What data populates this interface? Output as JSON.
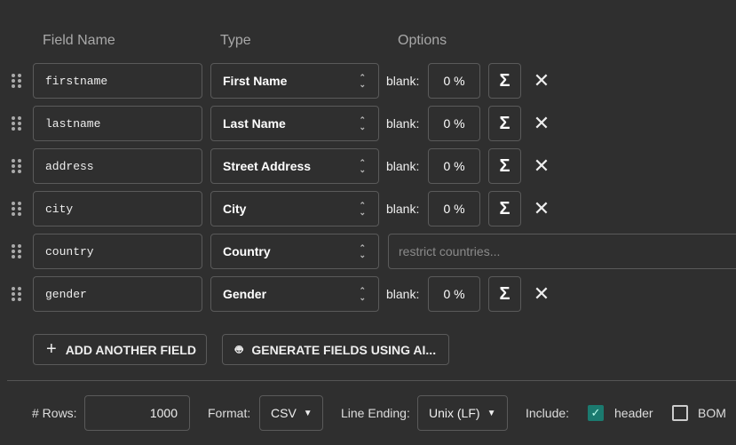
{
  "headers": {
    "field_name": "Field Name",
    "type": "Type",
    "options": "Options"
  },
  "fields": [
    {
      "name": "firstname",
      "type": "First Name",
      "blank_label": "blank:",
      "blank": "0 %"
    },
    {
      "name": "lastname",
      "type": "Last Name",
      "blank_label": "blank:",
      "blank": "0 %"
    },
    {
      "name": "address",
      "type": "Street Address",
      "blank_label": "blank:",
      "blank": "0 %"
    },
    {
      "name": "city",
      "type": "City",
      "blank_label": "blank:",
      "blank": "0 %"
    },
    {
      "name": "country",
      "type": "Country",
      "restrict_placeholder": "restrict countries..."
    },
    {
      "name": "gender",
      "type": "Gender",
      "blank_label": "blank:",
      "blank": "0 %"
    }
  ],
  "actions": {
    "add_field": "ADD ANOTHER FIELD",
    "generate_ai": "GENERATE FIELDS USING AI..."
  },
  "footer": {
    "rows_label": "# Rows:",
    "rows": "1000",
    "format_label": "Format:",
    "format": "CSV",
    "line_ending_label": "Line Ending:",
    "line_ending": "Unix (LF)",
    "include_label": "Include:",
    "header_label": "header",
    "header_checked": true,
    "bom_label": "BOM",
    "bom_checked": false
  },
  "colors": {
    "background": "#2f2f2f",
    "accent": "#1b7a6f"
  }
}
